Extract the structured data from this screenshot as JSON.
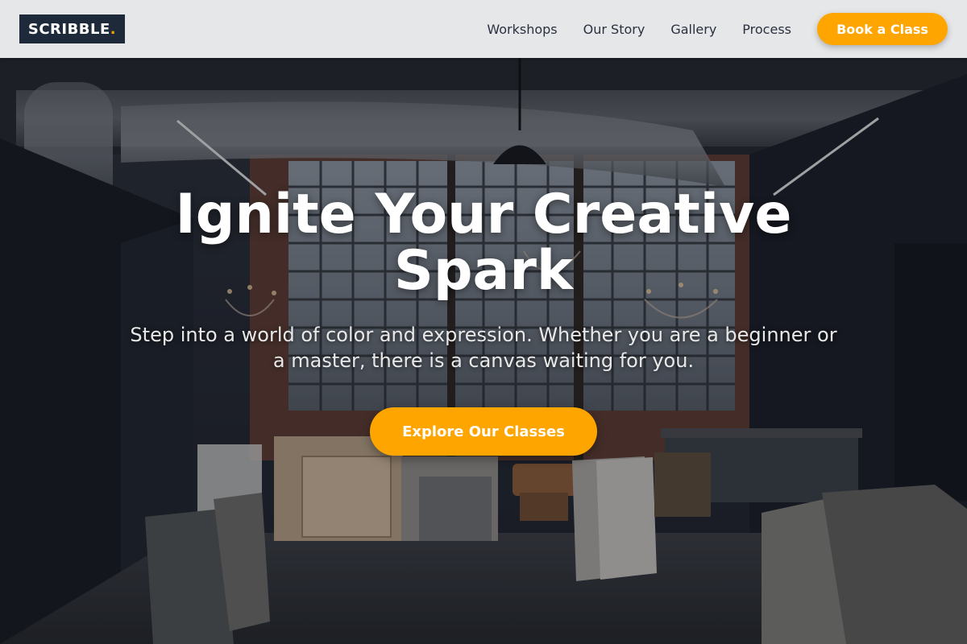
{
  "brand": {
    "name": "SCRIBBLE",
    "dot": "."
  },
  "nav": {
    "links": [
      "Workshops",
      "Our Story",
      "Gallery",
      "Process"
    ],
    "cta": "Book a Class"
  },
  "hero": {
    "title": "Ignite Your Creative Spark",
    "subtitle": "Step into a world of color and expression. Whether you are a beginner or a master, there is a canvas waiting for you.",
    "cta": "Explore Our Classes",
    "background": "art-studio-photo"
  },
  "colors": {
    "accent": "#ffa500",
    "logo_bg": "#1e2a3a",
    "header_bg": "#e6e7e8",
    "nav_text": "#2a3140"
  }
}
